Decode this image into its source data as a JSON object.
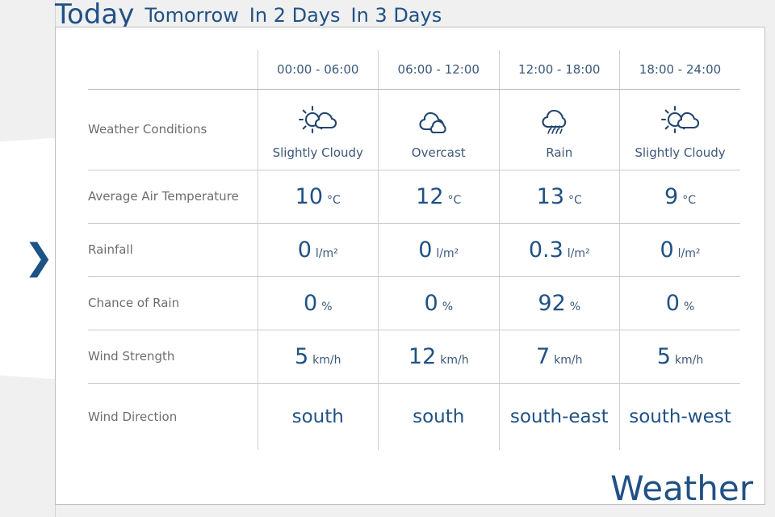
{
  "tabs": [
    {
      "label": "Today",
      "active": true
    },
    {
      "label": "Tomorrow",
      "active": false
    },
    {
      "label": "In 2 Days",
      "active": false
    },
    {
      "label": "In 3 Days",
      "active": false
    }
  ],
  "nav": {
    "next_arrow": "❯"
  },
  "page_title": "Weather",
  "table": {
    "corner_label": "",
    "columns": [
      "00:00 - 06:00",
      "06:00 - 12:00",
      "12:00 - 18:00",
      "18:00 - 24:00"
    ],
    "rows": [
      {
        "label": "Weather Conditions",
        "type": "conditions",
        "values": [
          "Slightly Cloudy",
          "Overcast",
          "Rain",
          "Slightly Cloudy"
        ],
        "icons": [
          "sun-cloud-icon",
          "overcast-cloud-icon",
          "rain-cloud-icon",
          "sun-cloud-icon"
        ]
      },
      {
        "label": "Average Air Temperature",
        "type": "value",
        "values": [
          "10",
          "12",
          "13",
          "9"
        ],
        "unit": "°C"
      },
      {
        "label": "Rainfall",
        "type": "value",
        "values": [
          "0",
          "0",
          "0.3",
          "0"
        ],
        "unit": "l/m²"
      },
      {
        "label": "Chance of Rain",
        "type": "value",
        "values": [
          "0",
          "0",
          "92",
          "0"
        ],
        "unit": "%"
      },
      {
        "label": "Wind Strength",
        "type": "value",
        "values": [
          "5",
          "12",
          "7",
          "5"
        ],
        "unit": "km/h"
      },
      {
        "label": "Wind Direction",
        "type": "text",
        "values": [
          "south",
          "south",
          "south-east",
          "south-west"
        ]
      }
    ]
  },
  "colors": {
    "accent_blue": "#205185",
    "label_gray": "#6d6d6d",
    "header_blue": "#3b587a",
    "page_background": "#f0f0f0",
    "card_border": "#c0c0c0"
  }
}
